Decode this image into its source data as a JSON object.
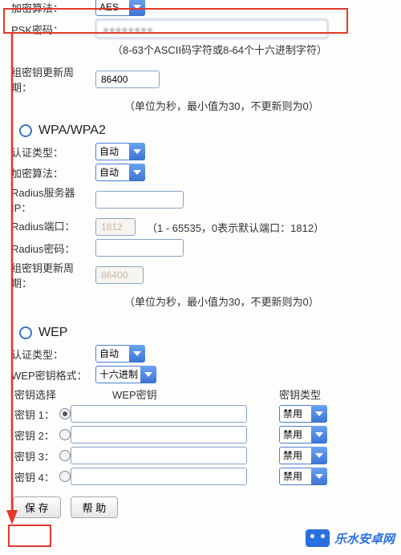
{
  "psk": {
    "encrypt_algo_label": "加密算法：",
    "encrypt_algo_value": "AES",
    "password_label": "PSK密码：",
    "password_value_masked": "●●●●●●●●",
    "password_hint": "（8-63个ASCII码字符或8-64个十六进制字符）",
    "group_key_label": "组密钥更新周期：",
    "group_key_value": "86400",
    "group_key_hint": "（单位为秒，最小值为30，不更新则为0）"
  },
  "wpa": {
    "heading": "WPA/WPA2",
    "auth_type_label": "认证类型：",
    "auth_type_value": "自动",
    "encrypt_algo_label": "加密算法：",
    "encrypt_algo_value": "自动",
    "radius_ip_label": "Radius服务器IP：",
    "radius_ip_value": "",
    "radius_port_label": "Radius端口：",
    "radius_port_value": "1812",
    "radius_port_hint": "（1 - 65535，0表示默认端口：1812）",
    "radius_pwd_label": "Radius密码：",
    "radius_pwd_value": "",
    "group_key_label": "组密钥更新周期：",
    "group_key_value": "86400",
    "group_key_hint": "（单位为秒，最小值为30，不更新则为0）"
  },
  "wep": {
    "heading": "WEP",
    "auth_type_label": "认证类型：",
    "auth_type_value": "自动",
    "key_format_label": "WEP密钥格式：",
    "key_format_value": "十六进制",
    "col_select": "密钥选择",
    "col_key": "WEP密钥",
    "col_type": "密钥类型",
    "rows": [
      {
        "label": "密钥 1：",
        "selected": true,
        "value": "",
        "type": "禁用"
      },
      {
        "label": "密钥 2：",
        "selected": false,
        "value": "",
        "type": "禁用"
      },
      {
        "label": "密钥 3：",
        "selected": false,
        "value": "",
        "type": "禁用"
      },
      {
        "label": "密钥 4：",
        "selected": false,
        "value": "",
        "type": "禁用"
      }
    ]
  },
  "buttons": {
    "save": "保 存",
    "help": "帮 助"
  },
  "watermark": "乐水安卓网"
}
